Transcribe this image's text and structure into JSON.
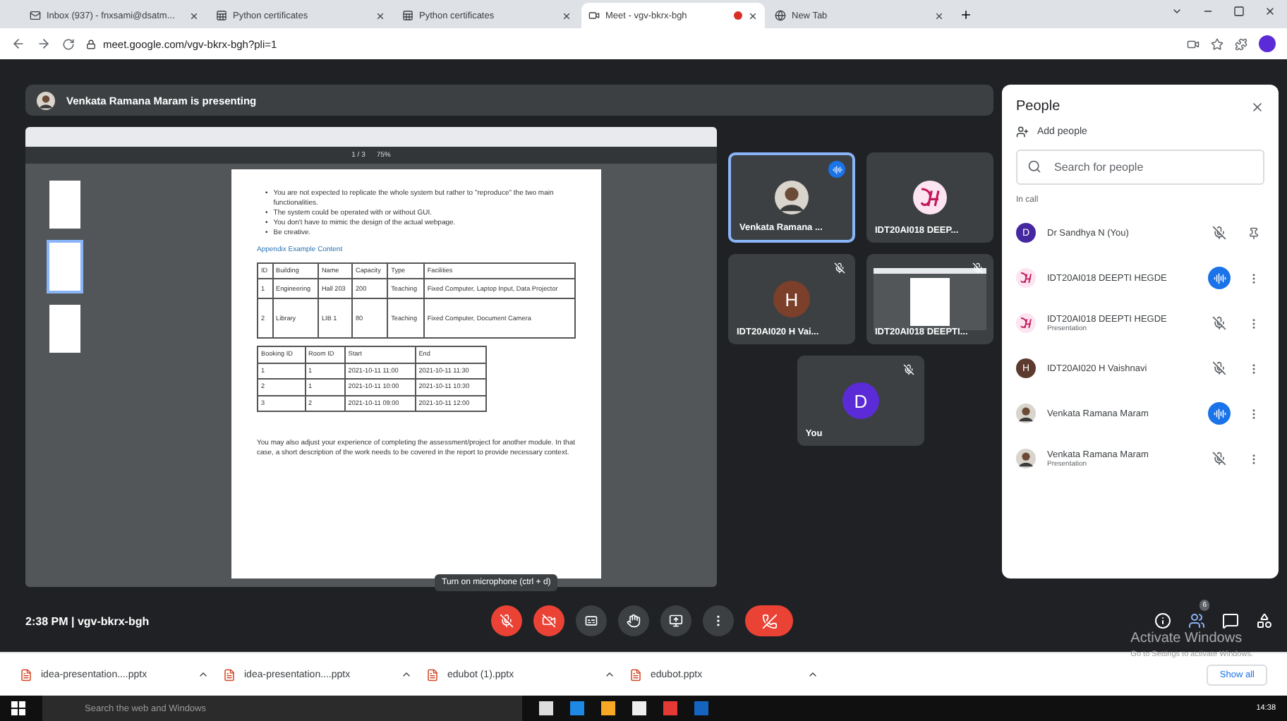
{
  "browser": {
    "tabs": [
      {
        "title": "Inbox (937) - fnxsami@dsatm...",
        "kind": "mail",
        "selected": false,
        "recording": false
      },
      {
        "title": "Python certificates",
        "kind": "sheet",
        "selected": false,
        "recording": false
      },
      {
        "title": "Python certificates",
        "kind": "sheet",
        "selected": false,
        "recording": false
      },
      {
        "title": "Meet - vgv-bkrx-bgh",
        "kind": "meet",
        "selected": true,
        "recording": true
      },
      {
        "title": "New Tab",
        "kind": "globe",
        "selected": false,
        "recording": false
      }
    ],
    "address": "meet.google.com/vgv-bkrx-bgh?pli=1"
  },
  "meet": {
    "banner": "Venkata Ramana Maram is presenting",
    "document": {
      "page": "1 / 3",
      "zoom": "75%",
      "marker": "•",
      "bullets": [
        "You are not expected to replicate the whole system but rather to \"reproduce\" the two main functionalities.",
        "The system could be operated with or without GUI.",
        "You don't have to mimic the design of the actual webpage.",
        "Be creative."
      ],
      "caption": "Appendix Example Content",
      "table": {
        "columns": [
          "ID",
          "Building",
          "Name",
          "Capacity",
          "Type",
          "Facilities"
        ],
        "rows": [
          [
            "1",
            "Engineering",
            "Hall 203",
            "200",
            "Teaching",
            "Fixed Computer, Laptop Input, Data Projector"
          ],
          [
            "2",
            "Library",
            "LIB 1",
            "80",
            "Teaching",
            "Fixed Computer, Document Camera"
          ]
        ]
      },
      "bookings": {
        "columns": [
          "Booking ID",
          "Room ID",
          "Start",
          "End"
        ],
        "rows": [
          [
            "1",
            "1",
            "2021-10-11 11:00",
            "2021-10-11 11:30"
          ],
          [
            "2",
            "1",
            "2021-10-11 10:00",
            "2021-10-11 10:30"
          ],
          [
            "3",
            "2",
            "2021-10-11 09:00",
            "2021-10-11 12:00"
          ]
        ]
      },
      "paragraph": "You may also adjust your experience of completing the assessment/project for another module. In that case, a short description of the work needs to be covered in the report to provide necessary context."
    },
    "tiles": [
      {
        "name": "Venkata Ramana ...",
        "kind": "photo",
        "speaking": true,
        "muted": false
      },
      {
        "name": "IDT20AI018 DEEP...",
        "kind": "logo",
        "speaking": false,
        "muted": false
      },
      {
        "name": "IDT20AI020 H Vai...",
        "kind": "letter",
        "letter": "H",
        "color": "#7b3f2a",
        "speaking": false,
        "muted": true
      },
      {
        "name": "IDT20AI018 DEEPTI...",
        "kind": "screen",
        "speaking": false,
        "muted": true
      },
      {
        "name": "You",
        "kind": "letter",
        "letter": "D",
        "color": "#5b2bd8",
        "speaking": false,
        "muted": true
      }
    ],
    "panel": {
      "title": "People",
      "add": "Add people",
      "search": {
        "placeholder": "Search for people"
      },
      "section": "In call",
      "people": [
        {
          "name": "Dr Sandhya N (You)",
          "kind": "letter",
          "letter": "D",
          "color": "#4527a0",
          "speaking": false
        },
        {
          "name": "IDT20AI018 DEEPTI HEGDE",
          "kind": "logo",
          "speaking": true
        },
        {
          "name": "IDT20AI018 DEEPTI HEGDE",
          "sub": "Presentation",
          "kind": "logo",
          "speaking": false
        },
        {
          "name": "IDT20AI020 H Vaishnavi",
          "kind": "letter",
          "letter": "H",
          "color": "#5d3a2e",
          "speaking": false
        },
        {
          "name": "Venkata Ramana Maram",
          "kind": "photo",
          "speaking": true
        },
        {
          "name": "Venkata Ramana Maram",
          "sub": "Presentation",
          "kind": "photo",
          "speaking": false
        }
      ]
    },
    "bar": {
      "time": "2:38 PM",
      "separator": "|",
      "code": "vgv-bkrx-bgh",
      "tooltip": "Turn on microphone (ctrl + d)",
      "mic_on": false,
      "camera_on": false,
      "people_count": "6"
    }
  },
  "downloads": {
    "items": [
      "idea-presentation....pptx",
      "idea-presentation....pptx",
      "edubot (1).pptx",
      "edubot.pptx"
    ],
    "show_all": "Show all"
  },
  "windows": {
    "activate": "Activate Windows",
    "activate_hint": "Go to Settings to activate Windows.",
    "search": "Search the web and Windows",
    "time": "14:38"
  }
}
